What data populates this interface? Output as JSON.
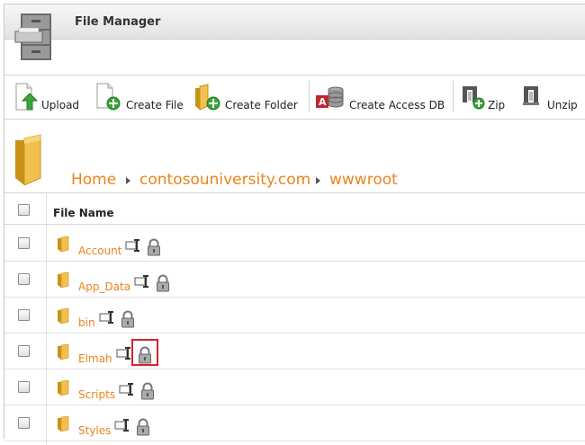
{
  "app": {
    "title": "File Manager"
  },
  "toolbar": {
    "upload": "Upload",
    "create_file": "Create File",
    "create_folder": "Create Folder",
    "create_access_db": "Create Access DB",
    "zip": "Zip",
    "unzip": "Unzip"
  },
  "breadcrumb": [
    "Home",
    "contosouniversity.com",
    "wwwroot"
  ],
  "table": {
    "header": "File Name",
    "rows": [
      {
        "name": "Account"
      },
      {
        "name": "App_Data"
      },
      {
        "name": "bin"
      },
      {
        "name": "Elmah",
        "highlighted_icon": "lock-icon"
      },
      {
        "name": "Scripts"
      },
      {
        "name": "Styles"
      }
    ]
  },
  "colors": {
    "link": "#e8851c",
    "highlight": "#d9232a"
  }
}
